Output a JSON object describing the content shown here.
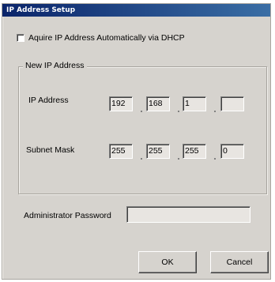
{
  "window": {
    "title": "IP Address Setup"
  },
  "dhcp": {
    "label": "Aquire IP Address Automatically via DHCP",
    "checked": false
  },
  "group": {
    "legend": "New IP Address"
  },
  "ip": {
    "label": "IP Address",
    "octets": [
      "192",
      "168",
      "1",
      ""
    ]
  },
  "mask": {
    "label": "Subnet Mask",
    "octets": [
      "255",
      "255",
      "255",
      "0"
    ]
  },
  "password": {
    "label": "Administrator Password",
    "value": ""
  },
  "buttons": {
    "ok": "OK",
    "cancel": "Cancel"
  }
}
